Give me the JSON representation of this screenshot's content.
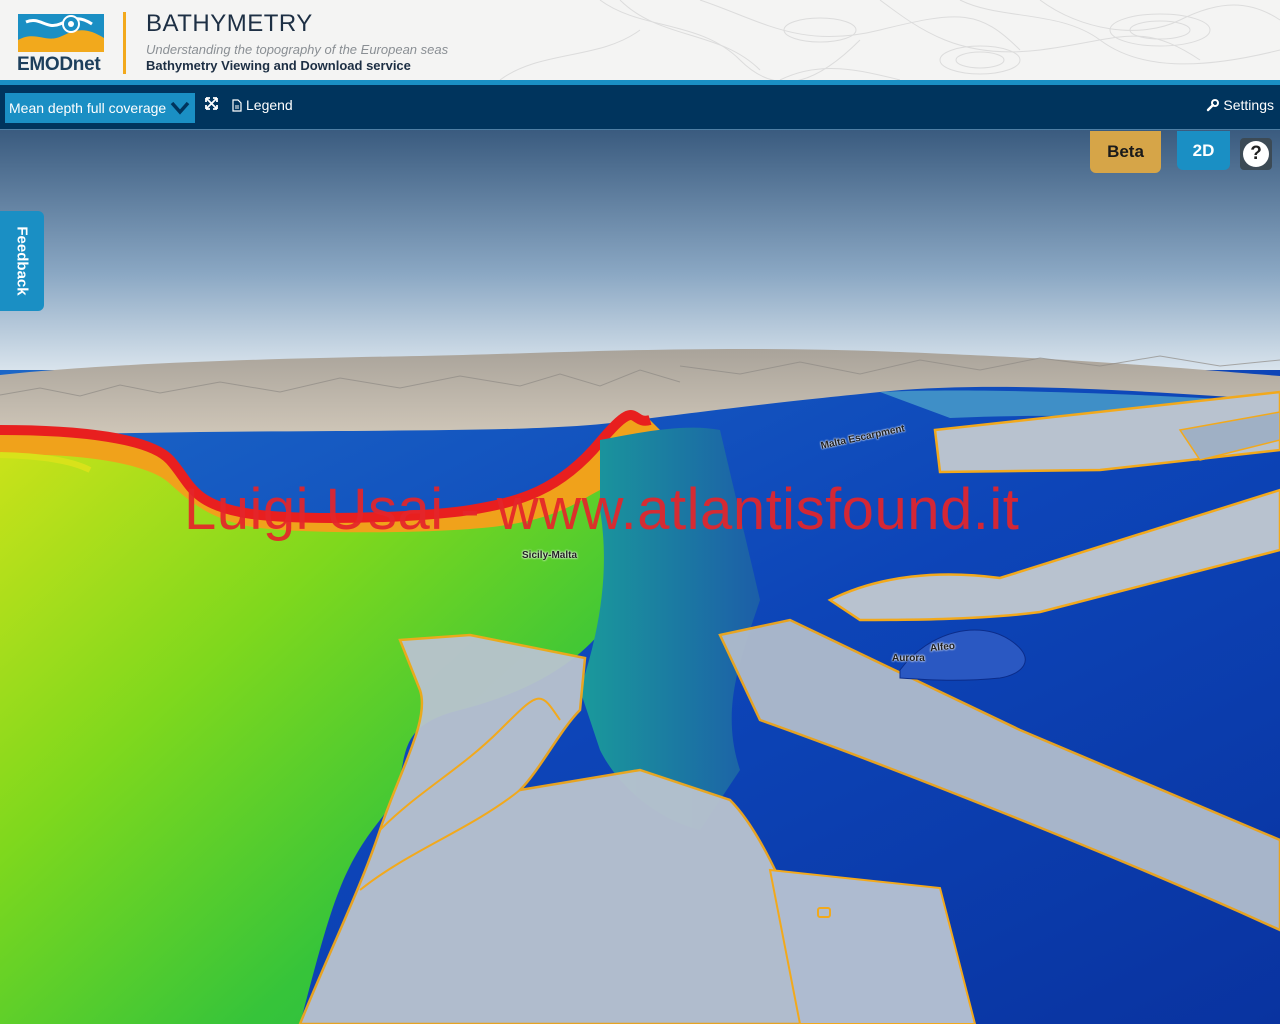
{
  "header": {
    "logo_text": "EMODnet",
    "title": "BATHYMETRY",
    "subtitle": "Understanding the topography of the European seas",
    "service": "Bathymetry Viewing and Download service"
  },
  "toolbar": {
    "layer_select": "Mean depth full coverage",
    "legend_label": "Legend",
    "settings_label": "Settings"
  },
  "map": {
    "beta_label": "Beta",
    "mode_label": "2D",
    "help_label": "?",
    "feedback_label": "Feedback",
    "watermark": "Luigi Usai - www.atlantisfound.it",
    "place_labels": [
      "Sicily-Malta",
      "Malta Escarpment",
      "Aurora",
      "Alfeo"
    ]
  },
  "colors": {
    "toolbar_bg": "#00345d",
    "accent_blue": "#1a8fc4",
    "beta_gold": "#d6a548",
    "logo_orange": "#f2a91c",
    "watermark_red": "#e5252a"
  },
  "icons": [
    "emodnet-logo-icon",
    "chevron-down-icon",
    "fullscreen-icon",
    "document-icon",
    "wrench-icon",
    "help-icon"
  ]
}
